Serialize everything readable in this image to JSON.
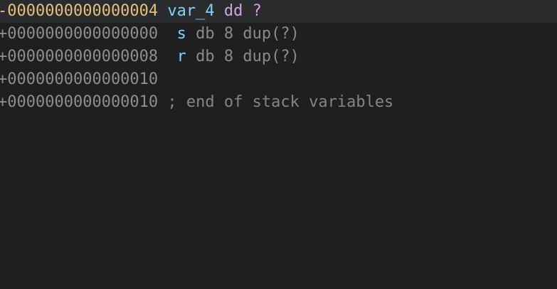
{
  "lines": [
    {
      "offset": "-0000000000000004",
      "sep": " ",
      "name": "var_4",
      "sep2": " ",
      "directive": "dd ?",
      "highlighted": true
    },
    {
      "offset": "+0000000000000000",
      "sep": "  ",
      "name": "s",
      "sep2": " ",
      "directive": "db 8 dup(?)"
    },
    {
      "offset": "+0000000000000008",
      "sep": "  ",
      "name": "r",
      "sep2": " ",
      "directive": "db 8 dup(?)"
    },
    {
      "offset": "+0000000000000010"
    },
    {
      "offset": "+0000000000000010",
      "sep": " ",
      "comment": "; end of stack variables"
    }
  ],
  "colors": {
    "background": "#1f1f1f",
    "highlight": "#2a2b2c",
    "offset_active": "#e5c07b",
    "name": "#7fd3fb",
    "keyword": "#d2a2e6",
    "muted": "#8a8a8a"
  }
}
